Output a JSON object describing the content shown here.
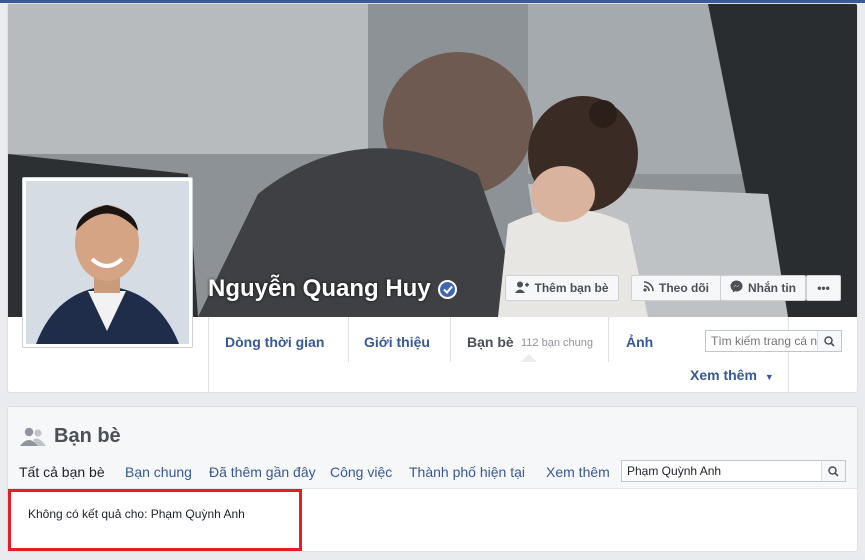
{
  "profile": {
    "name": "Nguyễn Quang Huy",
    "verified": true
  },
  "actions": {
    "add_friend": "Thêm bạn bè",
    "follow": "Theo dõi",
    "message": "Nhắn tin",
    "more": "•••"
  },
  "tabs": {
    "timeline": "Dòng thời gian",
    "about": "Giới thiệu",
    "friends": "Bạn bè",
    "friends_count": "112 bạn chung",
    "photos": "Ảnh",
    "more": "Xem thêm"
  },
  "page_search": {
    "placeholder": "Tìm kiếm trang cá nhân"
  },
  "friends_section": {
    "title": "Bạn bè",
    "subtabs": [
      "Tất cả bạn bè",
      "Bạn chung",
      "Đã thêm gần đây",
      "Công việc",
      "Thành phố hiện tại",
      "Xem thêm"
    ],
    "search_value": "Phạm Quỳnh Anh",
    "no_result_text": "Không có kết quả cho: Phạm Quỳnh Anh"
  },
  "colors": {
    "brand": "#3b5998",
    "link": "#365899",
    "highlight": "#e41e26"
  }
}
